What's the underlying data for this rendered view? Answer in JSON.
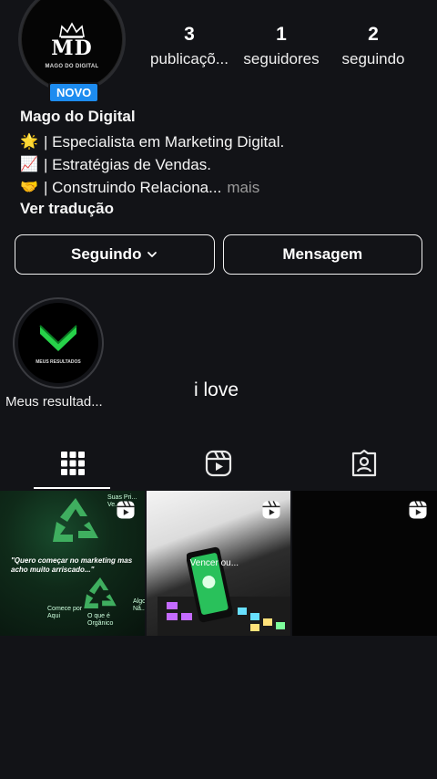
{
  "profile": {
    "avatar_text": "MD",
    "avatar_sub": "MAGO DO DIGITAL",
    "badge": "NOVO",
    "name": "Mago do Digital",
    "bio": [
      {
        "icon": "star-emoji",
        "glyph": "🌟",
        "text": "| Especialista em Marketing Digital."
      },
      {
        "icon": "chart-emoji",
        "glyph": "📈",
        "text": "| Estratégias de Vendas."
      },
      {
        "icon": "handshake-emoji",
        "glyph": "🤝",
        "text": "| Construindo Relaciona..."
      }
    ],
    "bio_more": "mais",
    "translate": "Ver tradução"
  },
  "stats": [
    {
      "num": "3",
      "label": "publicaçõ..."
    },
    {
      "num": "1",
      "label": "seguidores"
    },
    {
      "num": "2",
      "label": "seguindo"
    }
  ],
  "actions": {
    "following": "Seguindo",
    "message": "Mensagem"
  },
  "highlight": {
    "label": "Meus resultad...",
    "inner_text": "MEUS RESULTADOS"
  },
  "note": "i love",
  "tabs": [
    {
      "icon": "grid-icon",
      "active": true
    },
    {
      "icon": "reels-icon",
      "active": false
    },
    {
      "icon": "tagged-icon",
      "active": false
    }
  ],
  "posts": [
    {
      "text": "\"Quero começar no marketing mas acho muito arriscado...\"",
      "extra1": "Comece por Aqui",
      "extra2": "O que é Orgânico",
      "extra3": "Suas Pri... Ve...",
      "extra4": "Algo... Nã..."
    },
    {
      "text": "Vencer ou..."
    },
    {
      "text": ""
    }
  ],
  "colors": {
    "background": "#121317",
    "badge": "#1d8cf0",
    "accent_green": "#27d34a"
  }
}
